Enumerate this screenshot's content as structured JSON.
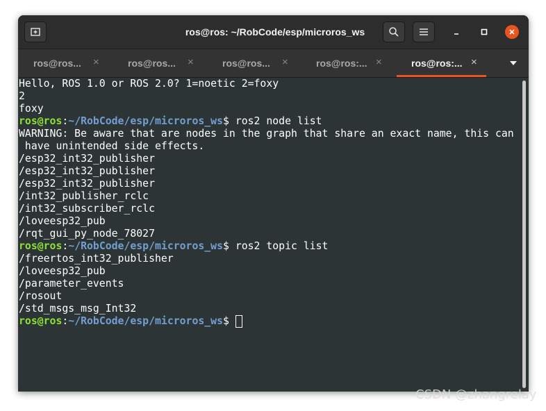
{
  "window": {
    "title": "ros@ros: ~/RobCode/esp/microros_ws"
  },
  "tabs": [
    {
      "label": "ros@ros...",
      "active": false
    },
    {
      "label": "ros@ros...",
      "active": false
    },
    {
      "label": "ros@ros...",
      "active": false
    },
    {
      "label": "ros@ros:...",
      "active": false
    },
    {
      "label": "ros@ros:...",
      "active": true
    }
  ],
  "tab_close_glyph": "×",
  "prompt": {
    "user_host": "ros@ros",
    "separator": ":",
    "path": "~/RobCode/esp/microros_ws",
    "symbol": "$ "
  },
  "terminal": {
    "lines": [
      {
        "type": "text",
        "text": "Hello, ROS 1.0 or ROS 2.0? 1=noetic 2=foxy"
      },
      {
        "type": "text",
        "text": "2"
      },
      {
        "type": "text",
        "text": "foxy"
      },
      {
        "type": "prompt",
        "command": "ros2 node list"
      },
      {
        "type": "text",
        "text": "WARNING: Be aware that are nodes in the graph that share an exact name, this can"
      },
      {
        "type": "text",
        "text": " have unintended side effects."
      },
      {
        "type": "text",
        "text": "/esp32_int32_publisher"
      },
      {
        "type": "text",
        "text": "/esp32_int32_publisher"
      },
      {
        "type": "text",
        "text": "/esp32_int32_publisher"
      },
      {
        "type": "text",
        "text": "/int32_publisher_rclc"
      },
      {
        "type": "text",
        "text": "/int32_subscriber_rclc"
      },
      {
        "type": "text",
        "text": "/loveesp32_pub"
      },
      {
        "type": "text",
        "text": "/rqt_gui_py_node_78027"
      },
      {
        "type": "prompt",
        "command": "ros2 topic list"
      },
      {
        "type": "text",
        "text": "/freertos_int32_publisher"
      },
      {
        "type": "text",
        "text": "/loveesp32_pub"
      },
      {
        "type": "text",
        "text": "/parameter_events"
      },
      {
        "type": "text",
        "text": "/rosout"
      },
      {
        "type": "text",
        "text": "/std_msgs_msg_Int32"
      },
      {
        "type": "prompt",
        "command": "",
        "cursor": true
      }
    ]
  },
  "watermark": "CSDN @zhangrelay",
  "colors": {
    "accent": "#e95420",
    "prompt_user": "#8ae234",
    "prompt_path": "#729fcf",
    "terminal_bg": "#2d3436"
  },
  "icons": {
    "new_tab": "new-tab-icon",
    "search": "search-icon",
    "menu": "hamburger-menu-icon",
    "minimize": "minimize-icon",
    "maximize": "maximize-icon",
    "close": "close-icon",
    "tabs_dropdown": "chevron-down-icon"
  }
}
